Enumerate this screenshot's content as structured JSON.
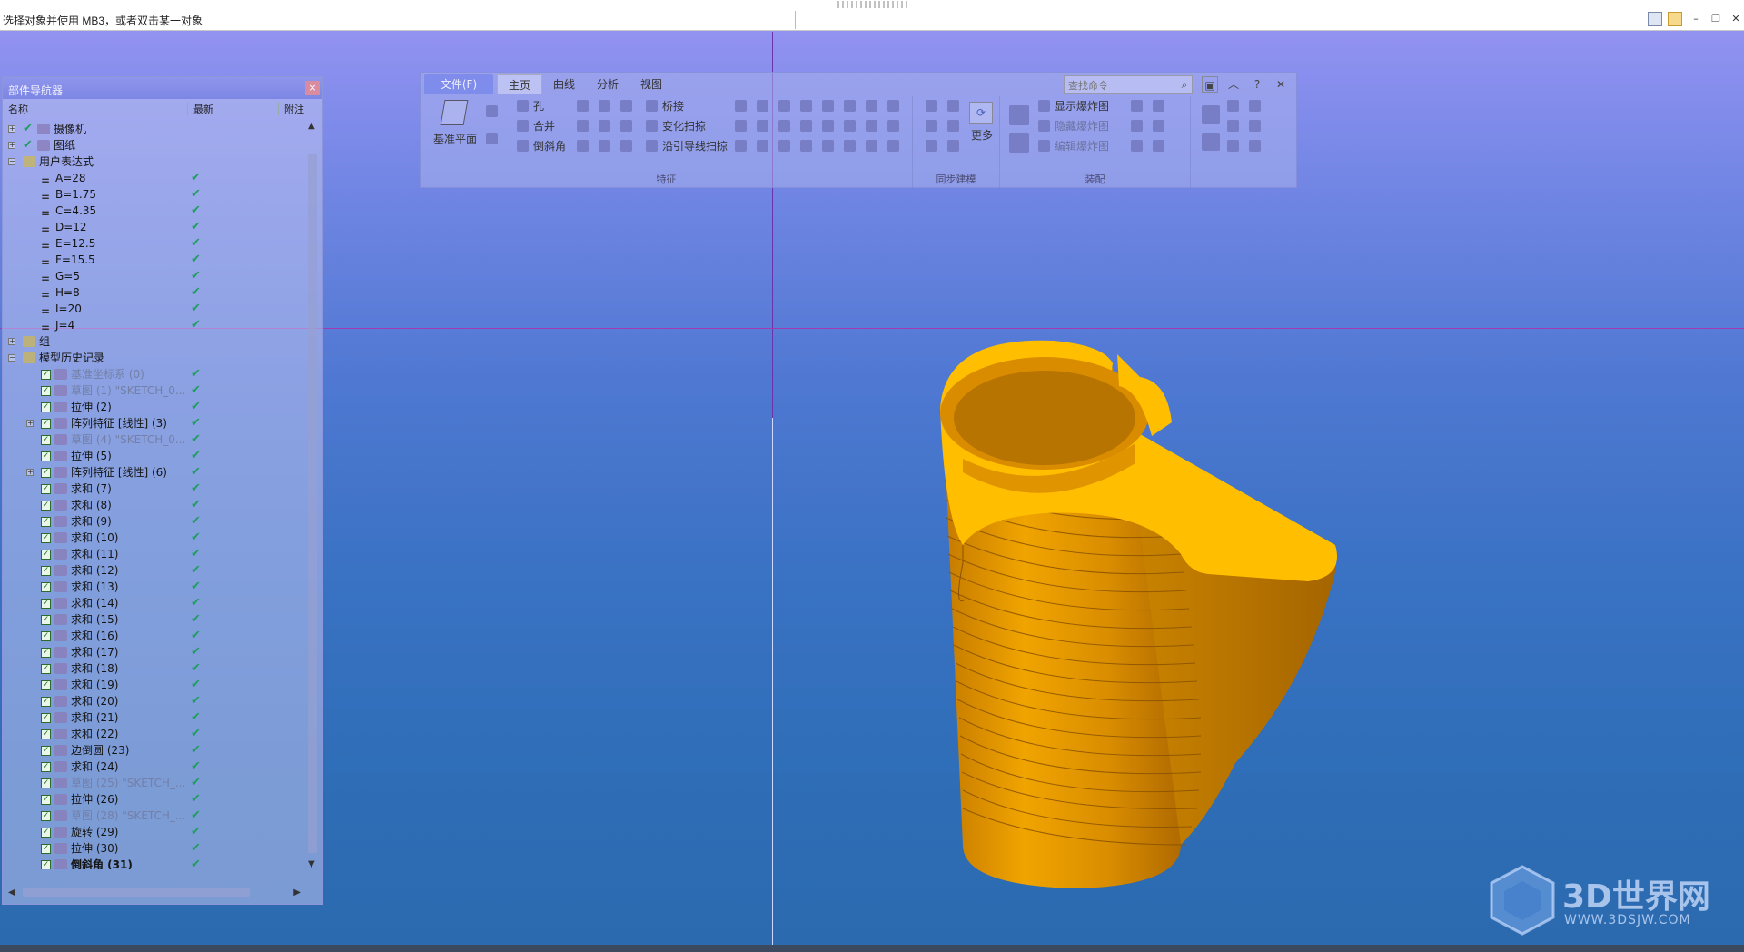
{
  "status_message": "选择对象并使用 MB3，或者双击某一对象",
  "navigator": {
    "title": "部件导航器",
    "columns": [
      "名称",
      "最新",
      "附注"
    ],
    "top_items": [
      {
        "label": "摄像机"
      },
      {
        "label": "图纸"
      },
      {
        "label": "用户表达式"
      }
    ],
    "expressions": [
      "A=28",
      "B=1.75",
      "C=4.35",
      "D=12",
      "E=12.5",
      "F=15.5",
      "G=5",
      "H=8",
      "I=20",
      "J=4"
    ],
    "group_label": "组",
    "history_label": "模型历史记录",
    "history": [
      {
        "label": "基准坐标系 (0)",
        "dim": true
      },
      {
        "label": "草图 (1) \"SKETCH_0...",
        "dim": true
      },
      {
        "label": "拉伸 (2)",
        "dim": false
      },
      {
        "label": "阵列特征 [线性] (3)",
        "dim": false,
        "expand": true
      },
      {
        "label": "草图 (4) \"SKETCH_0...",
        "dim": true
      },
      {
        "label": "拉伸 (5)",
        "dim": false
      },
      {
        "label": "阵列特征 [线性] (6)",
        "dim": false,
        "expand": true
      },
      {
        "label": "求和 (7)",
        "dim": false
      },
      {
        "label": "求和 (8)",
        "dim": false
      },
      {
        "label": "求和 (9)",
        "dim": false
      },
      {
        "label": "求和 (10)",
        "dim": false
      },
      {
        "label": "求和 (11)",
        "dim": false
      },
      {
        "label": "求和 (12)",
        "dim": false
      },
      {
        "label": "求和 (13)",
        "dim": false
      },
      {
        "label": "求和 (14)",
        "dim": false
      },
      {
        "label": "求和 (15)",
        "dim": false
      },
      {
        "label": "求和 (16)",
        "dim": false
      },
      {
        "label": "求和 (17)",
        "dim": false
      },
      {
        "label": "求和 (18)",
        "dim": false
      },
      {
        "label": "求和 (19)",
        "dim": false
      },
      {
        "label": "求和 (20)",
        "dim": false
      },
      {
        "label": "求和 (21)",
        "dim": false
      },
      {
        "label": "求和 (22)",
        "dim": false
      },
      {
        "label": "边倒圆 (23)",
        "dim": false
      },
      {
        "label": "求和 (24)",
        "dim": false
      },
      {
        "label": "草图 (25) \"SKETCH_...",
        "dim": true
      },
      {
        "label": "拉伸 (26)",
        "dim": false
      },
      {
        "label": "草图 (28) \"SKETCH_...",
        "dim": true
      },
      {
        "label": "旋转 (29)",
        "dim": false
      },
      {
        "label": "拉伸 (30)",
        "dim": false
      },
      {
        "label": "倒斜角 (31)",
        "dim": false,
        "bold": true
      }
    ]
  },
  "ribbon": {
    "file_tab": "文件(F)",
    "tabs": [
      "主页",
      "曲线",
      "分析",
      "视图"
    ],
    "active_tab": "主页",
    "search_placeholder": "查找命令",
    "feature": {
      "datum_label": "基准平面",
      "hole": "孔",
      "unite": "合并",
      "chamfer": "倒斜角",
      "bridge": "桥接",
      "variable_sweep": "变化扫掠",
      "sweep_guide": "沿引导线扫掠",
      "group_label": "特征"
    },
    "sync": {
      "more": "更多",
      "group_label": "同步建模"
    },
    "assembly": {
      "show_product": "显示爆炸图",
      "hide_product": "隐藏爆炸图",
      "edit_product": "编辑爆炸图",
      "group_label": "装配"
    }
  },
  "watermark": {
    "brand": "3D世界网",
    "url": "WWW.3DSJW.COM"
  },
  "colors": {
    "model": "#f2a500",
    "background_top": "#9b94f3",
    "background_bottom": "#2b6aae"
  }
}
